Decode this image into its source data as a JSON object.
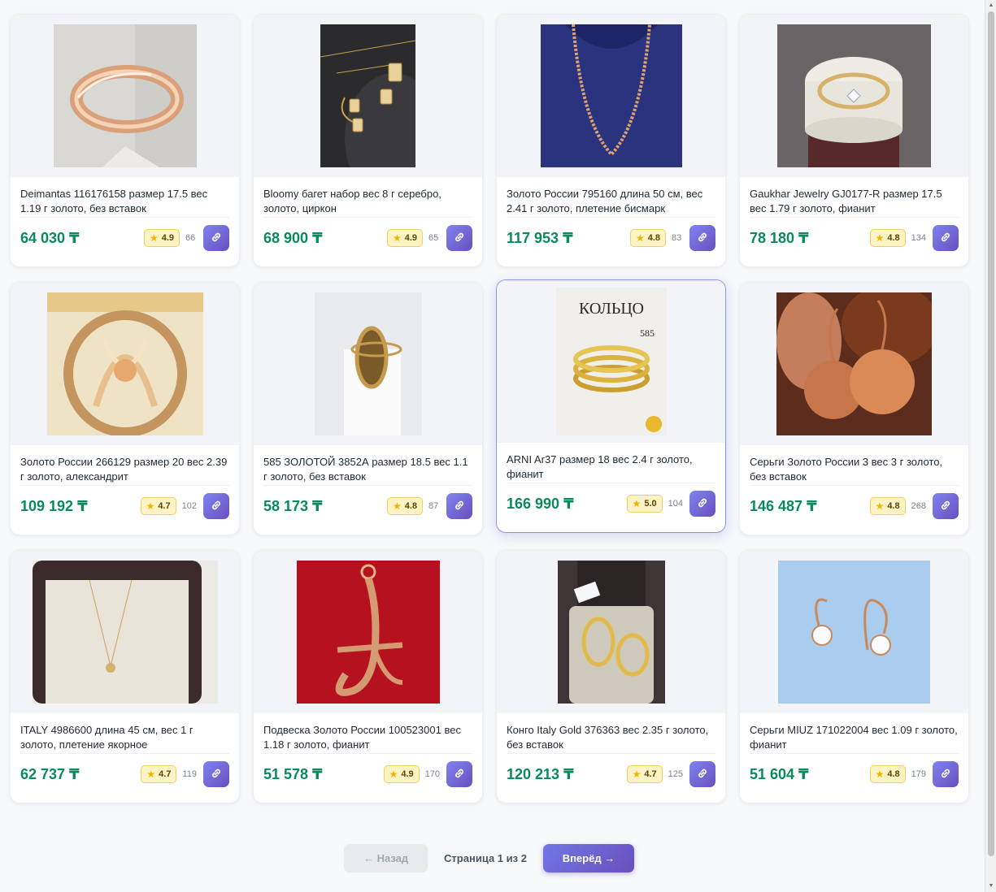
{
  "colors": {
    "price": "#0a8a5a",
    "accent": "#6a4fbc",
    "rating_bg": "#fdf3c4",
    "active_border": "#8a95e8"
  },
  "products": [
    {
      "title": "Deimantas 116176158 размер 17.5 вес 1.19 г золото, без вставок",
      "price": "64 030 ₸",
      "rating": "4.9",
      "reviews": "66",
      "image": "rose-gold-wedding-band",
      "link_icon": "link-icon"
    },
    {
      "title": "Bloomy багет набор вес 8 г серебро, золото, циркон",
      "price": "68 900 ₸",
      "rating": "4.9",
      "reviews": "65",
      "image": "baguette-jewelry-set",
      "link_icon": "link-icon"
    },
    {
      "title": "Золото России 795160 длина 50 см, вес 2.41 г золото, плетение бисмарк",
      "price": "117 953 ₸",
      "rating": "4.8",
      "reviews": "83",
      "image": "gold-chain-on-bust",
      "link_icon": "link-icon"
    },
    {
      "title": "Gaukhar Jewelry GJ0177-R размер 17.5 вес 1.79 г золото, фианит",
      "price": "78 180 ₸",
      "rating": "4.8",
      "reviews": "134",
      "image": "ring-with-stone-on-stand",
      "link_icon": "link-icon"
    },
    {
      "title": "Золото России 266129 размер 20 вес 2.39 г золото, александрит",
      "price": "109 192 ₸",
      "rating": "4.7",
      "reviews": "102",
      "image": "ornate-openwork-ring",
      "link_icon": "link-icon"
    },
    {
      "title": "585 ЗОЛОТОЙ 3852А размер 18.5 вес 1.1 г золото, без вставок",
      "price": "58 173 ₸",
      "rating": "4.8",
      "reviews": "87",
      "image": "marquise-signet-ring",
      "link_icon": "link-icon"
    },
    {
      "title": "ARNI Ar37 размер 18 вес 2.4 г золото, фианит",
      "price": "166 990 ₸",
      "rating": "5.0",
      "reviews": "104",
      "image": "coiled-gold-ring-poster",
      "link_icon": "link-icon",
      "active": true,
      "poster_text": "КОЛЬЦО",
      "poster_sub": "585"
    },
    {
      "title": "Серьги Золото России 3 вес 3 г золото, без вставок",
      "price": "146 487 ₸",
      "rating": "4.8",
      "reviews": "268",
      "image": "filigree-ball-earrings",
      "link_icon": "link-icon"
    },
    {
      "title": "ITALY 4986600 длина 45 см, вес 1 г золото, плетение якорное",
      "price": "62 737 ₸",
      "rating": "4.7",
      "reviews": "119",
      "image": "pendant-necklace-in-box",
      "link_icon": "link-icon"
    },
    {
      "title": "Подвеска Золото России 100523001 вес 1.18 г золото, фианит",
      "price": "51 578 ₸",
      "rating": "4.9",
      "reviews": "170",
      "image": "letter-pendant-on-red",
      "link_icon": "link-icon"
    },
    {
      "title": "Конго Italy Gold 376363 вес 2.35 г золото, без вставок",
      "price": "120 213 ₸",
      "rating": "4.7",
      "reviews": "125",
      "image": "hoop-earrings-in-box",
      "link_icon": "link-icon"
    },
    {
      "title": "Серьги MIUZ 171022004 вес 1.09 г золото, фианит",
      "price": "51 604 ₸",
      "rating": "4.8",
      "reviews": "179",
      "image": "stud-drop-earrings-on-blue",
      "link_icon": "link-icon"
    }
  ],
  "pagination": {
    "prev_label": "← Назад",
    "info": "Страница 1 из 2",
    "next_label": "Вперёд →"
  }
}
